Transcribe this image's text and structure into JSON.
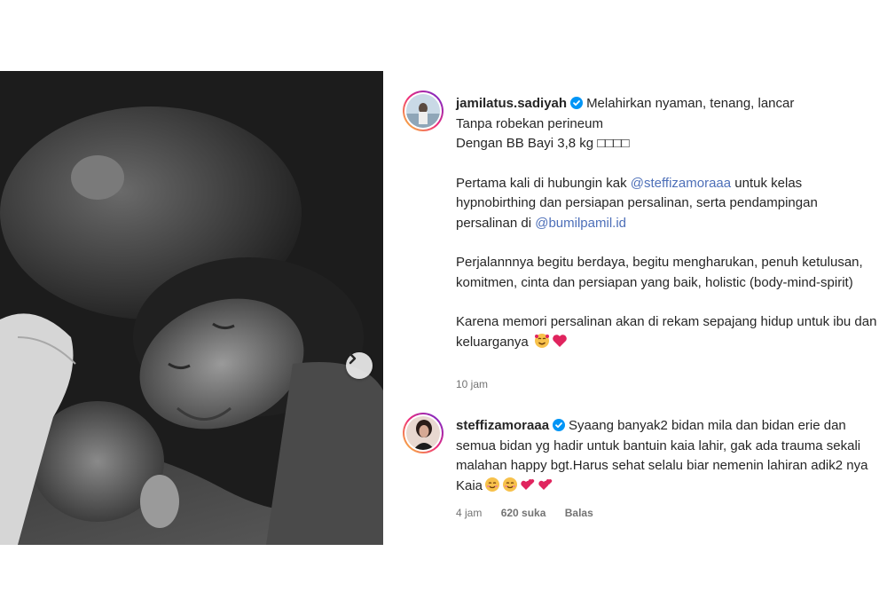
{
  "post": {
    "author": {
      "username": "jamilatus.sadiyah",
      "verified_icon": "verified-badge-icon",
      "avatar_icon": "avatar-photo-icon"
    },
    "caption": {
      "line1": "Melahirkan nyaman, tenang, lancar",
      "line2": "Tanpa robekan perineum",
      "line3": "Dengan BB Bayi 3,8 kg □□□□",
      "p2_a": "Pertama kali di hubungin kak ",
      "p2_mention1": "@steffizamoraaa",
      "p2_b": " untuk kelas hypnobirthing dan persiapan persalinan, serta pendampingan persalinan di ",
      "p2_mention2": "@bumilpamil.id",
      "p3": "Perjalannnya begitu berdaya, begitu mengharukan, penuh ketulusan, komitmen, cinta dan persiapan yang baik, holistic (body-mind-spirit)",
      "p4": "Karena memori persalinan akan di rekam sepajang hidup untuk ibu dan keluarganya"
    },
    "time": "10 jam",
    "next_icon": "chevron-right-icon"
  },
  "comment": {
    "username": "steffizamoraaa",
    "text": "Syaang banyak2 bidan mila dan bidan erie dan semua bidan yg hadir untuk bantuin kaia lahir, gak ada trauma sekali malahan happy bgt.Harus sehat selalu biar nemenin lahiran adik2 nya Kaia",
    "time": "4 jam",
    "likes": "620 suka",
    "reply": "Balas"
  },
  "colors": {
    "mention": "#4d6fb8",
    "verified": "#0095f6",
    "meta": "#737373"
  }
}
